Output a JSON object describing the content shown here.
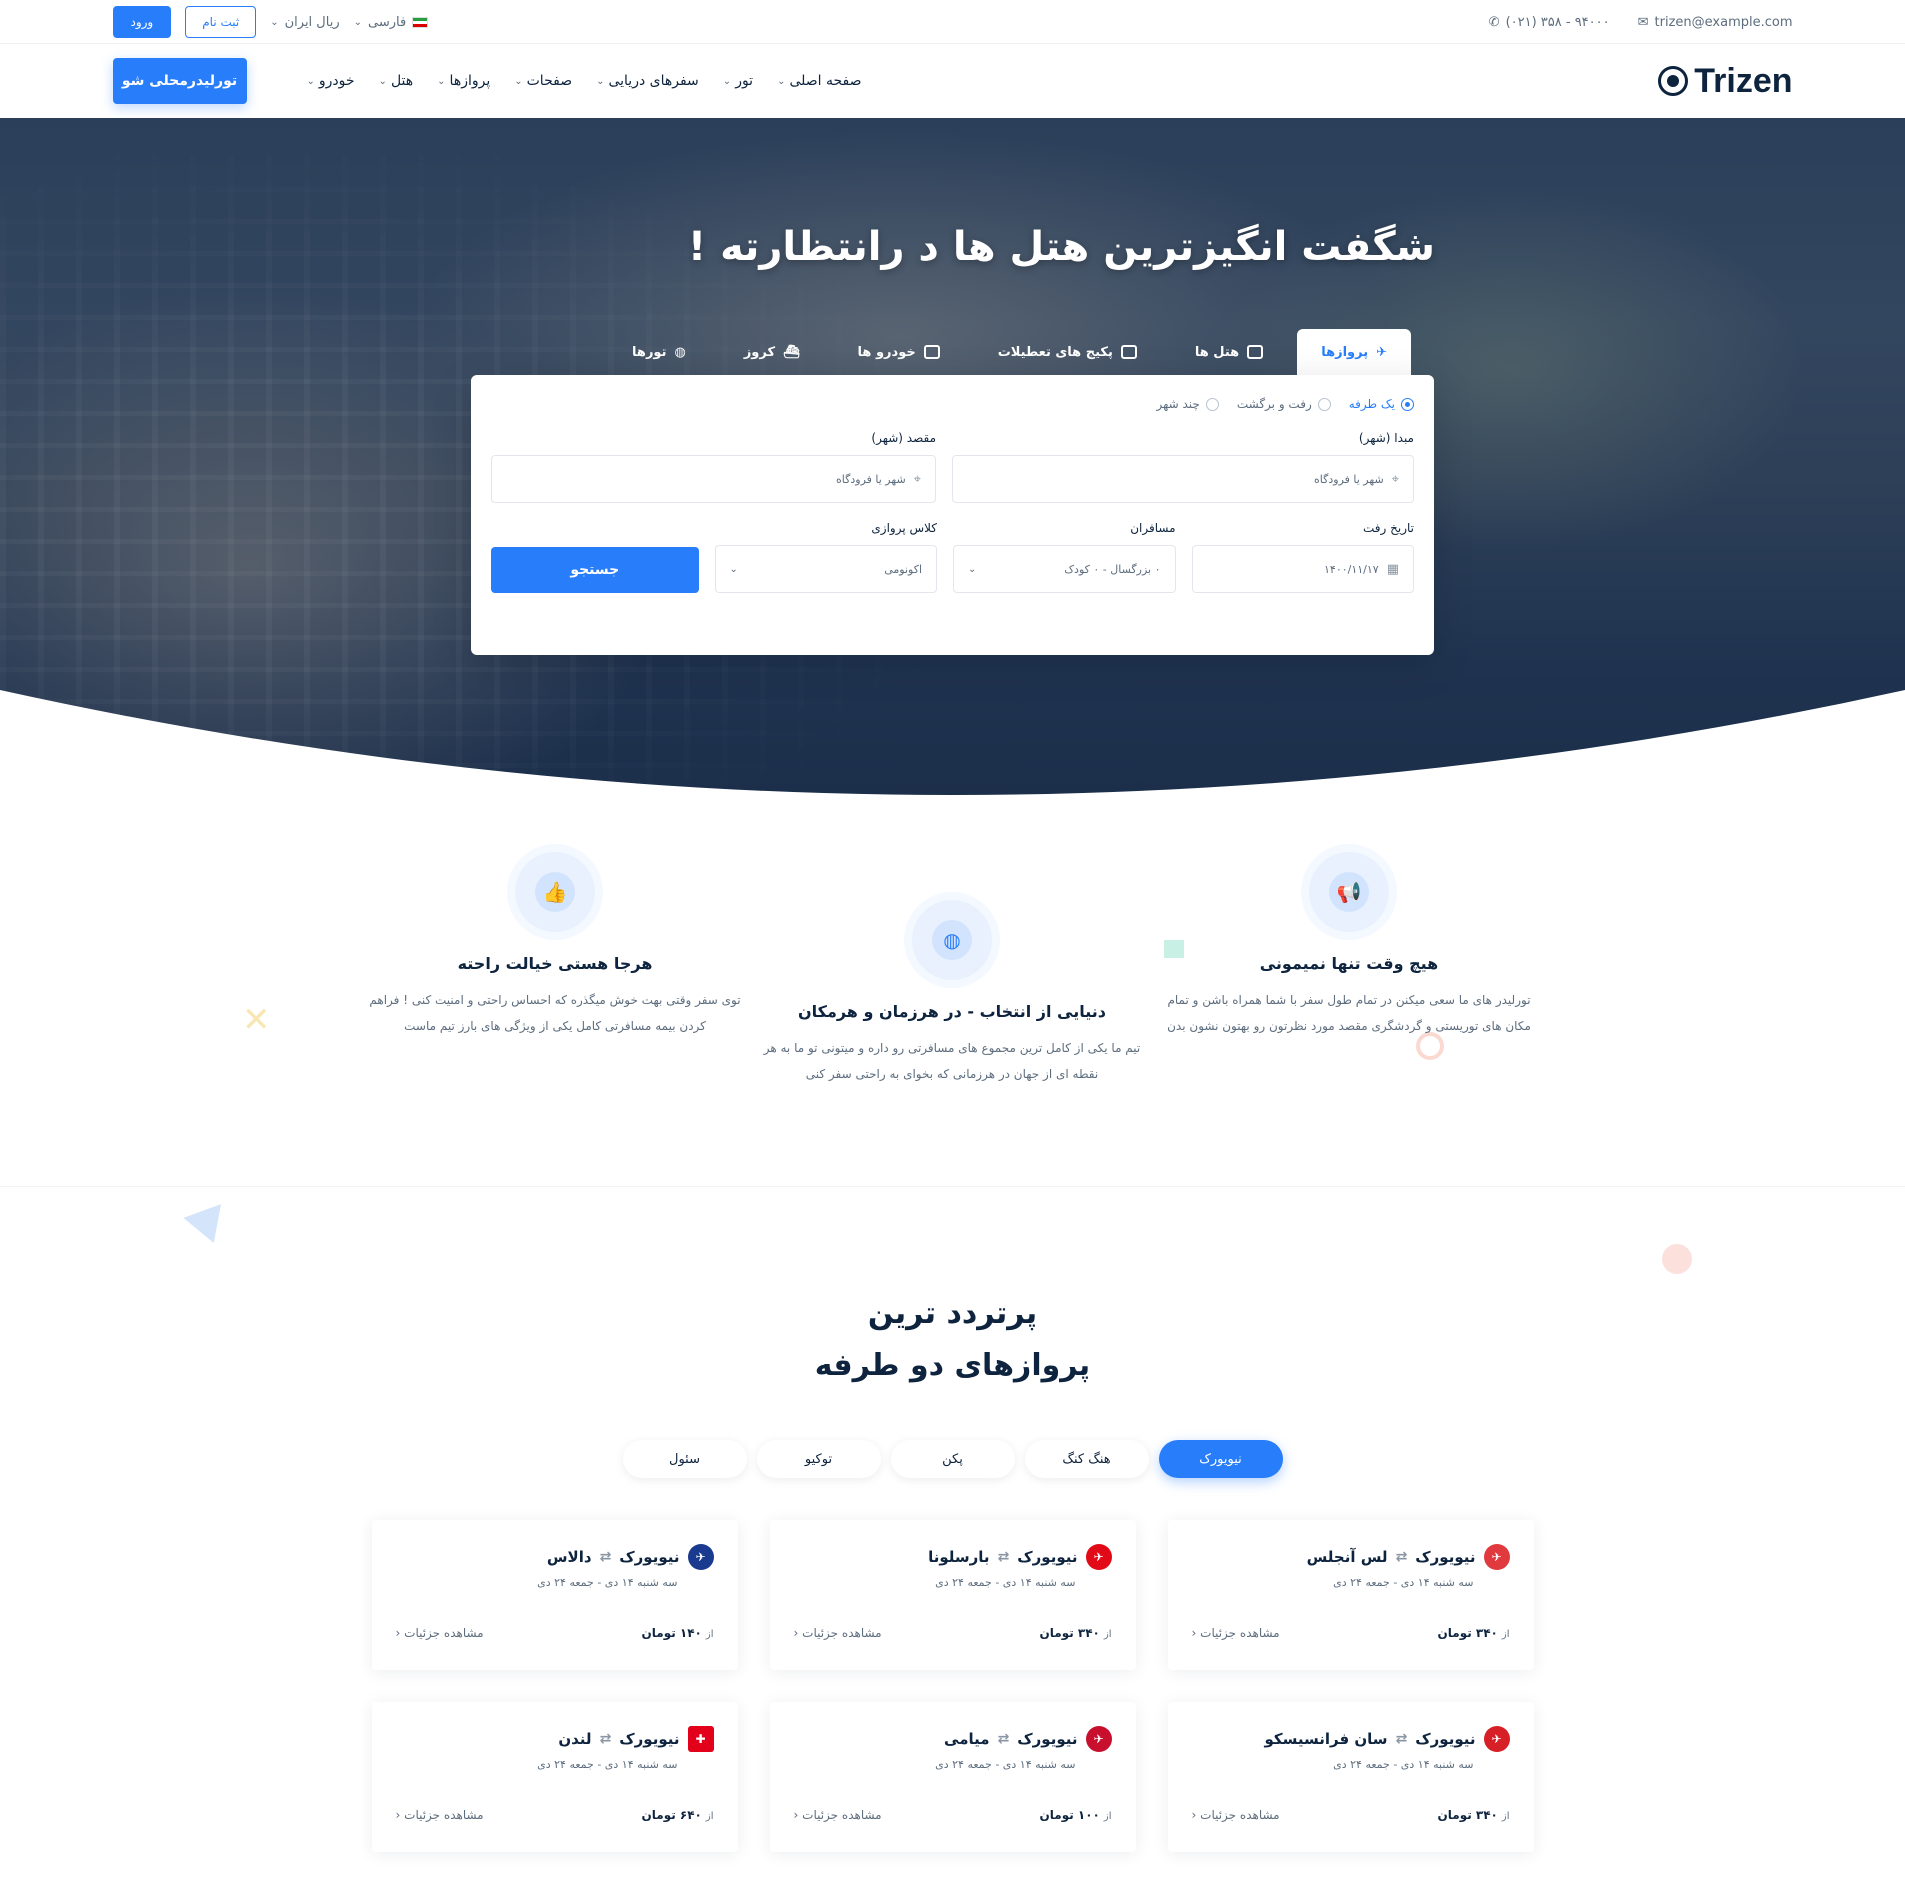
{
  "topbar": {
    "phone": "(۰۲۱) ۳۵۸ - ۹۴۰۰۰",
    "email": "trizen@example.com",
    "language": "فارسی",
    "currency": "ریال ایران",
    "signup_label": "ثبت نام",
    "login_label": "ورود"
  },
  "nav": {
    "logo_text": "Trizen",
    "items": [
      {
        "label": "صفحه اصلی"
      },
      {
        "label": "تور"
      },
      {
        "label": "سفرهای دریایی"
      },
      {
        "label": "صفحات"
      },
      {
        "label": "پروازها"
      },
      {
        "label": "هتل"
      },
      {
        "label": "خودرو"
      }
    ],
    "cta_label": "تورلیدرمحلی شو"
  },
  "hero": {
    "title": "شگفت انگیزترین هتل ها د رانتظارته !",
    "tabs": [
      {
        "label": "پروازها",
        "icon": "plane-icon",
        "active": true
      },
      {
        "label": "هتل ها",
        "icon": "bed-icon",
        "active": false
      },
      {
        "label": "پکیج های تعطیلات",
        "icon": "bag-icon",
        "active": false
      },
      {
        "label": "خودرو ها",
        "icon": "car-icon",
        "active": false
      },
      {
        "label": "کروز",
        "icon": "ship-icon",
        "active": false
      },
      {
        "label": "تورها",
        "icon": "globe-icon",
        "active": false
      }
    ]
  },
  "search": {
    "trip_types": [
      {
        "label": "یک طرفه",
        "checked": true
      },
      {
        "label": "رفت و برگشت",
        "checked": false
      },
      {
        "label": "چند شهر",
        "checked": false
      }
    ],
    "origin_label": "مبدا (شهر)",
    "origin_placeholder": "شهر یا فرودگاه",
    "destination_label": "مقصد (شهر)",
    "destination_placeholder": "شهر یا فرودگاه",
    "date_label": "تاریخ رفت",
    "date_value": "۱۴۰۰/۱۱/۱۷",
    "passengers_label": "مسافران",
    "passengers_value": "۰ بزرگسال - ۰ کودک",
    "class_label": "کلاس پروازی",
    "class_value": "اکونومی",
    "search_button": "جستجو"
  },
  "features": [
    {
      "title": "هیچ وقت تنها نمیمونی",
      "text": "تورلیدر های ما سعی میکنن در تمام طول سفر با شما همراه باشن و تمام مکان های توریستی و گردشگری مقصد مورد نظرتون رو بهتون نشون بدن",
      "icon": "megaphone-icon"
    },
    {
      "title": "دنیایی از انتخاب - در هرزمان و هرمکان",
      "text": "تیم ما یکی از کامل ترین مجموع های مسافرتی رو داره و میتونی تو ما به هر نقطه ای از جهان در هرزمانی که بخوای به راحتی سفر کنی",
      "icon": "globe-icon"
    },
    {
      "title": "هرجا هستی خیالت راحته",
      "text": "توی سفر وقتی بهت خوش میگذره که احساس راحتی و امنیت کنی ! فراهم کردن بیمه مسافرتی کامل یکی از ویژگی های بارز تیم ماست",
      "icon": "thumbs-up-icon"
    }
  ],
  "popular": {
    "title_line1": "پرتردد ترین",
    "title_line2": "پروازهای دو طرفه",
    "city_tabs": [
      {
        "label": "نیویورک",
        "active": true
      },
      {
        "label": "هنگ کنگ",
        "active": false
      },
      {
        "label": "پکن",
        "active": false
      },
      {
        "label": "توکیو",
        "active": false
      },
      {
        "label": "سئول",
        "active": false
      }
    ],
    "cards": [
      {
        "from": "نیویورک",
        "to": "لس آنجلس",
        "date": "سه شنبه ۱۴ دی - جمعه ۲۴ دی",
        "price_prefix": "از",
        "price": "۳۴۰ تومان",
        "details": "مشاهده جزئیات",
        "airline_color": "#e03a3e",
        "airline_icon": "airline-logo-icon"
      },
      {
        "from": "نیویورک",
        "to": "بارسلونا",
        "date": "سه شنبه ۱۴ دی - جمعه ۲۴ دی",
        "price_prefix": "از",
        "price": "۳۴۰ تومان",
        "details": "مشاهده جزئیات",
        "airline_color": "#e30a17",
        "airline_icon": "airline-logo-icon"
      },
      {
        "from": "نیویورک",
        "to": "دالاس",
        "date": "سه شنبه ۱۴ دی - جمعه ۲۴ دی",
        "price_prefix": "از",
        "price": "۱۴۰ تومان",
        "details": "مشاهده جزئیات",
        "airline_color": "#1a3a8f",
        "airline_icon": "airline-logo-icon"
      },
      {
        "from": "نیویورک",
        "to": "سان فرانسیسکو",
        "date": "سه شنبه ۱۴ دی - جمعه ۲۴ دی",
        "price_prefix": "از",
        "price": "۳۴۰ تومان",
        "details": "مشاهده جزئیات",
        "airline_color": "#d61f26",
        "airline_icon": "airline-logo-icon"
      },
      {
        "from": "نیویورک",
        "to": "میامی",
        "date": "سه شنبه ۱۴ دی - جمعه ۲۴ دی",
        "price_prefix": "از",
        "price": "۱۰۰ تومان",
        "details": "مشاهده جزئیات",
        "airline_color": "#c8102e",
        "airline_icon": "airline-logo-icon"
      },
      {
        "from": "نیویورک",
        "to": "لندن",
        "date": "سه شنبه ۱۴ دی - جمعه ۲۴ دی",
        "price_prefix": "از",
        "price": "۶۴۰ تومان",
        "details": "مشاهده جزئیات",
        "airline_color": "#e2001a",
        "airline_icon": "airline-logo-icon"
      }
    ]
  },
  "colors": {
    "primary": "#287dfa",
    "dark": "#0d233e",
    "muted": "#5d6d7e"
  }
}
